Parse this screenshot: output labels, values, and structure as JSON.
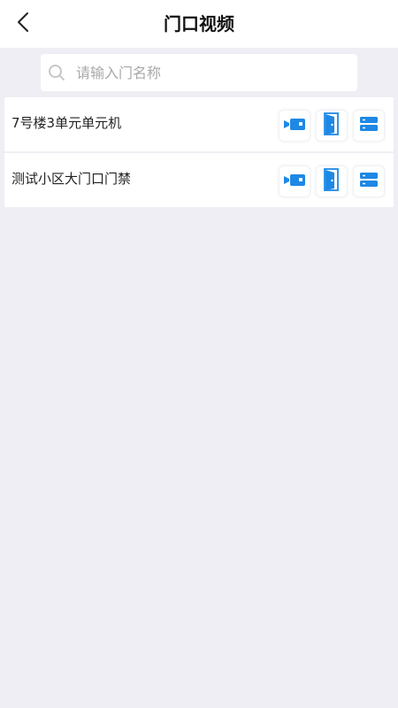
{
  "header": {
    "title": "门口视频",
    "back_icon": "chevron-left-icon"
  },
  "search": {
    "placeholder": "请输入门名称",
    "value": "",
    "icon": "search-icon"
  },
  "doors": [
    {
      "name": "7号楼3单元单元机"
    },
    {
      "name": "测试小区大门口门禁"
    }
  ],
  "row_actions": [
    {
      "icon": "video-camera-icon"
    },
    {
      "icon": "door-open-icon"
    },
    {
      "icon": "list-menu-icon"
    }
  ],
  "colors": {
    "accent": "#1E88E5",
    "background": "#EEEEF4",
    "surface": "#FFFFFF"
  }
}
